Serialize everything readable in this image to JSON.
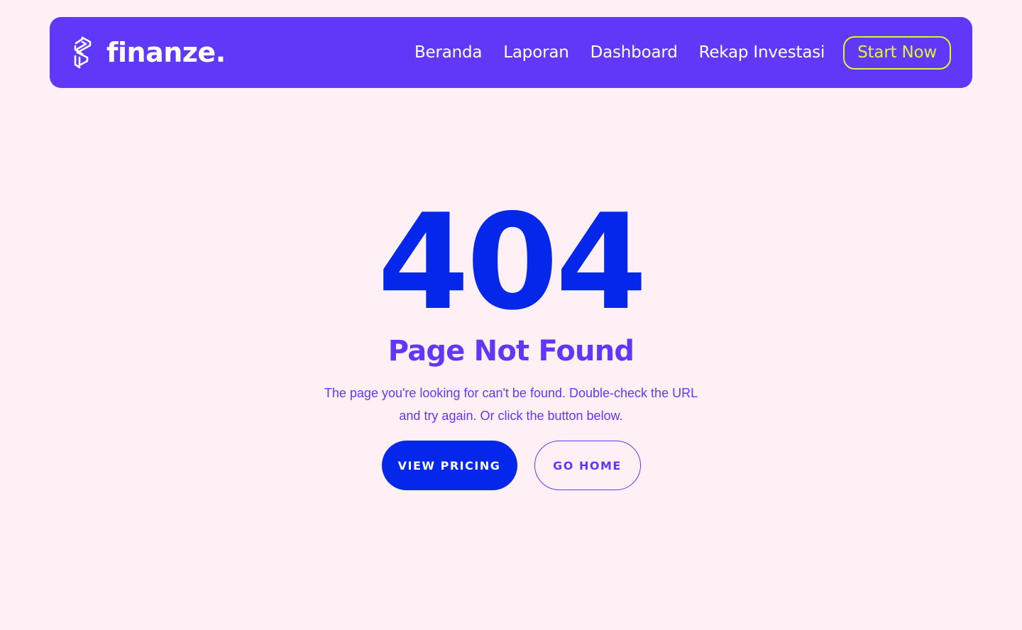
{
  "colors": {
    "background": "#fff0f6",
    "navbar": "#6038f8",
    "accent_lime": "#d9f53d",
    "primary_blue": "#0427ea",
    "purple": "#6038f8"
  },
  "header": {
    "logo_icon": "finanze-logo-icon",
    "brand": "finanze.",
    "nav": [
      {
        "label": "Beranda"
      },
      {
        "label": "Laporan"
      },
      {
        "label": "Dashboard"
      },
      {
        "label": "Rekap Investasi"
      }
    ],
    "cta_label": "Start Now"
  },
  "error": {
    "code": "404",
    "title": "Page Not Found",
    "description": "The page you're looking for can't be found. Double-check the URL and try again. Or click the button below."
  },
  "actions": {
    "primary_label": "VIEW PRICING",
    "secondary_label": "GO HOME"
  }
}
